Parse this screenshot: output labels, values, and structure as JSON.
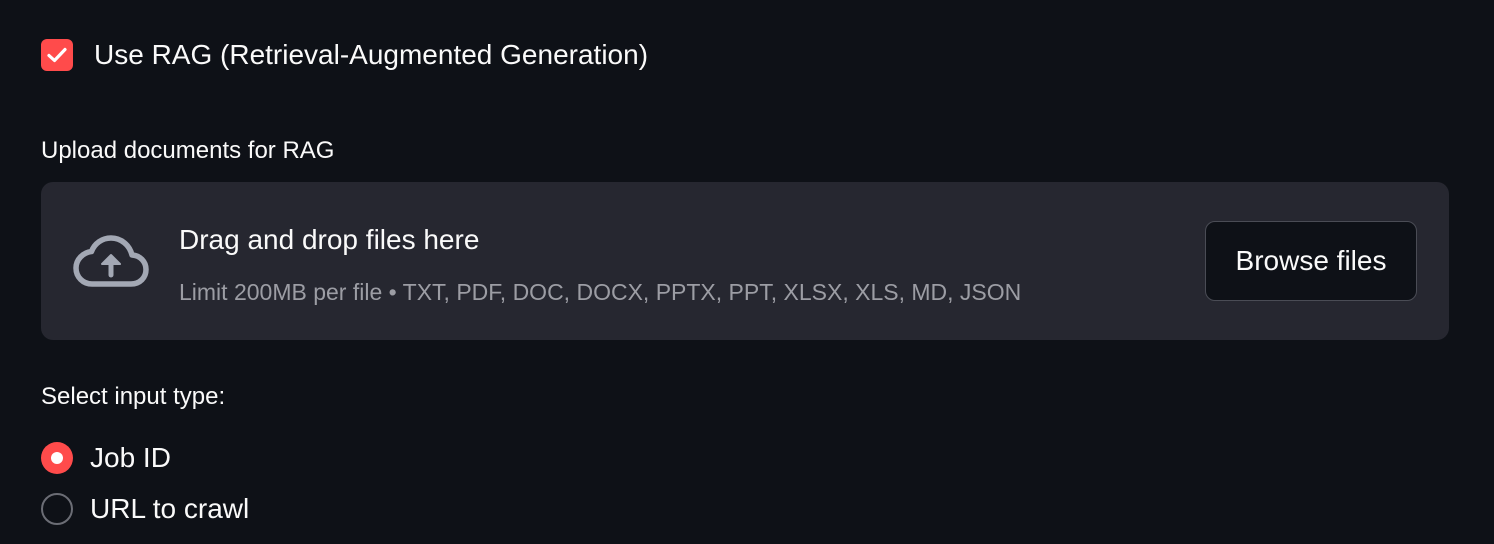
{
  "rag_toggle": {
    "label": "Use RAG (Retrieval-Augmented Generation)",
    "checked": true
  },
  "uploader": {
    "label": "Upload documents for RAG",
    "title": "Drag and drop files here",
    "subtitle": "Limit 200MB per file • TXT, PDF, DOC, DOCX, PPTX, PPT, XLSX, XLS, MD, JSON",
    "browse_label": "Browse files",
    "icon": "cloud-upload-icon"
  },
  "input_type": {
    "label": "Select input type:",
    "options": [
      {
        "label": "Job ID",
        "selected": true
      },
      {
        "label": "URL to crawl",
        "selected": false
      }
    ]
  },
  "colors": {
    "background": "#0e1117",
    "accent": "#ff4b4b",
    "dropzone": "#262730",
    "muted_text": "#9c9da4"
  }
}
